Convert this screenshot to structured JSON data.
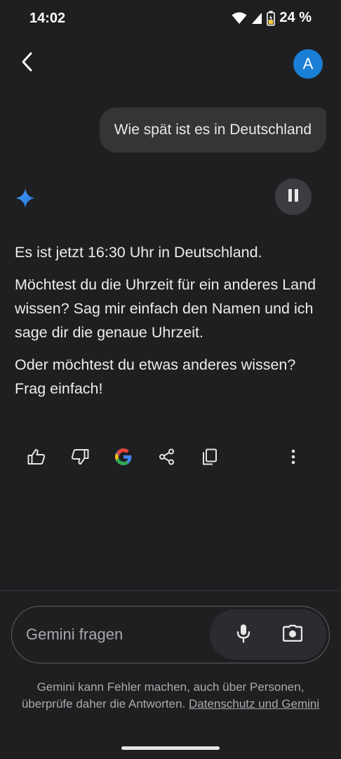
{
  "status_bar": {
    "time": "14:02",
    "battery": "24 %",
    "icons": [
      "wifi-icon",
      "signal-icon",
      "battery-icon"
    ]
  },
  "header": {
    "back_icon": "back-arrow-icon",
    "avatar_letter": "A",
    "avatar_color": "#1a7fd4"
  },
  "conversation": {
    "user_message": "Wie spät ist es in Deutschland",
    "response_paragraphs": [
      "Es ist jetzt 16:30 Uhr in Deutschland.",
      "Möchtest du die Uhrzeit für ein anderes Land wissen? Sag mir einfach den Namen und ich sage dir die genaue Uhrzeit.",
      "Oder möchtest du etwas anderes wissen? Frag einfach!"
    ],
    "response_icon": "gemini-sparkle-icon",
    "playback_icon": "pause-icon",
    "actions": [
      "thumbs-up-icon",
      "thumbs-down-icon",
      "google-icon",
      "share-icon",
      "copy-icon",
      "more-vertical-icon"
    ]
  },
  "input": {
    "placeholder": "Gemini fragen",
    "mic_icon": "microphone-icon",
    "camera_icon": "camera-icon"
  },
  "disclaimer": {
    "text": "Gemini kann Fehler machen, auch über Personen, überprüfe daher die Antworten. ",
    "link": "Datenschutz und Gemini"
  },
  "colors": {
    "background": "#1f1f21",
    "bubble": "#333537",
    "accent": "#1a7fd4"
  }
}
